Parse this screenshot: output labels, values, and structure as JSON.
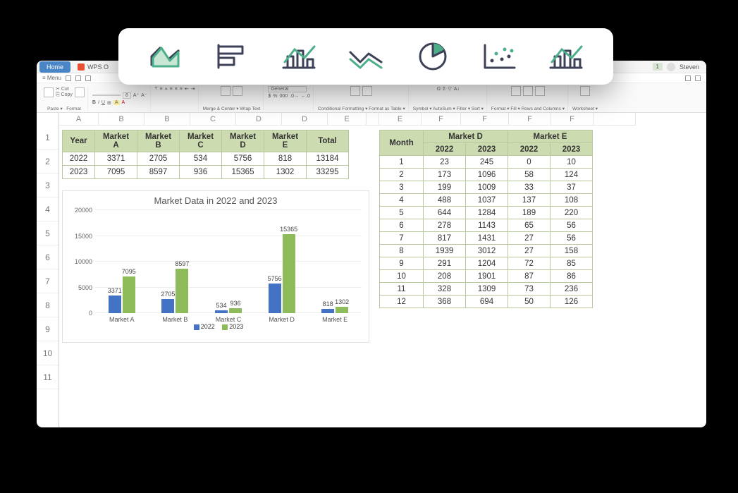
{
  "window": {
    "home": "Home",
    "doc": "WPS O",
    "badge": "1",
    "user": "Steven"
  },
  "menubar": {
    "menu": "Menu"
  },
  "ribbon": {
    "paste": "Paste",
    "cut": "Cut",
    "copy": "Copy",
    "format": "Format",
    "fontsize": "8",
    "merge": "Merge & Center",
    "wrap": "Wrap Text",
    "general": "General",
    "condfmt": "Conditional Formatting",
    "fmttable": "Format as Table",
    "symbol": "Symbol",
    "autosum": "AutoSum",
    "filter": "Filter",
    "sort": "Sort",
    "formatcell": "Format",
    "fill": "Fill",
    "rowscols": "Rows and Columns",
    "worksheet": "Worksheet"
  },
  "cols": {
    "A": "A",
    "B": "B",
    "C": "C",
    "D": "D",
    "E": "E",
    "Fblank": "",
    "Erep": "E",
    "F": "F",
    "F2": "F"
  },
  "rows": [
    "1",
    "2",
    "3",
    "4",
    "5",
    "6",
    "7",
    "8",
    "9",
    "10",
    "11"
  ],
  "summary": {
    "headers": {
      "year": "Year",
      "ma": "Market A",
      "mb": "Market B",
      "mc": "Market C",
      "md": "Market D",
      "me": "Market E",
      "total": "Total"
    },
    "rows": [
      {
        "year": "2022",
        "a": "3371",
        "b": "2705",
        "c": "534",
        "d": "5756",
        "e": "818",
        "total": "13184"
      },
      {
        "year": "2023",
        "a": "7095",
        "b": "8597",
        "c": "936",
        "d": "15365",
        "e": "1302",
        "total": "33295"
      }
    ]
  },
  "monthly": {
    "headers": {
      "month": "Month",
      "mdgroup": "Market D",
      "megroup": "Market E",
      "y22": "2022",
      "y23": "2023"
    },
    "rows": [
      {
        "m": "1",
        "d22": "23",
        "d23": "245",
        "e22": "0",
        "e23": "10"
      },
      {
        "m": "2",
        "d22": "173",
        "d23": "1096",
        "e22": "58",
        "e23": "124"
      },
      {
        "m": "3",
        "d22": "199",
        "d23": "1009",
        "e22": "33",
        "e23": "37"
      },
      {
        "m": "4",
        "d22": "488",
        "d23": "1037",
        "e22": "137",
        "e23": "108"
      },
      {
        "m": "5",
        "d22": "644",
        "d23": "1284",
        "e22": "189",
        "e23": "220"
      },
      {
        "m": "6",
        "d22": "278",
        "d23": "1143",
        "e22": "65",
        "e23": "56"
      },
      {
        "m": "7",
        "d22": "817",
        "d23": "1431",
        "e22": "27",
        "e23": "56"
      },
      {
        "m": "8",
        "d22": "1939",
        "d23": "3012",
        "e22": "27",
        "e23": "158"
      },
      {
        "m": "9",
        "d22": "291",
        "d23": "1204",
        "e22": "72",
        "e23": "85"
      },
      {
        "m": "10",
        "d22": "208",
        "d23": "1901",
        "e22": "87",
        "e23": "86"
      },
      {
        "m": "11",
        "d22": "328",
        "d23": "1309",
        "e22": "73",
        "e23": "236"
      },
      {
        "m": "12",
        "d22": "368",
        "d23": "694",
        "e22": "50",
        "e23": "126"
      }
    ]
  },
  "chart_data": {
    "type": "bar",
    "title": "Market Data in 2022 and 2023",
    "categories": [
      "Market A",
      "Market B",
      "Market C",
      "Market D",
      "Market E"
    ],
    "series": [
      {
        "name": "2022",
        "color": "#4472c4",
        "values": [
          3371,
          2705,
          534,
          5756,
          818
        ]
      },
      {
        "name": "2023",
        "color": "#8fbc5a",
        "values": [
          7095,
          8597,
          936,
          15365,
          1302
        ]
      }
    ],
    "ylim": [
      0,
      20000
    ],
    "yticks": [
      0,
      5000,
      10000,
      15000,
      20000
    ],
    "legend": {
      "l22": "2022",
      "l23": "2023"
    }
  }
}
